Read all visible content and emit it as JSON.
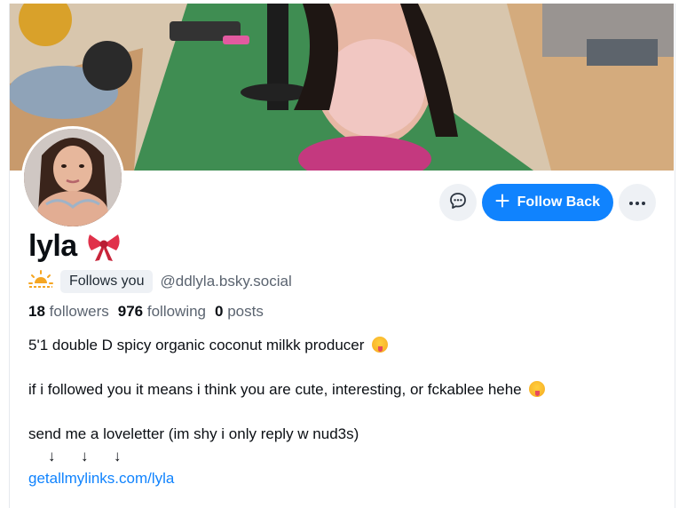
{
  "profile": {
    "display_name": "lyla",
    "name_emoji": "bow-emoji",
    "follows_you": "Follows you",
    "handle": "@ddlyla.bsky.social",
    "stats": {
      "followers_count": "18",
      "followers_label": "followers",
      "following_count": "976",
      "following_label": "following",
      "posts_count": "0",
      "posts_label": "posts"
    },
    "bio": {
      "line1": "5'1 double D spicy organic coconut milkk producer",
      "line2": "if i followed you it means i think you are cute, interesting, or fckablee hehe",
      "line3": "send me a loveletter (im shy i only reply w nud3s)",
      "arrows": [
        "↓",
        "↓",
        "↓"
      ],
      "link": "getallmylinks.com/lyla"
    }
  },
  "actions": {
    "message_icon": "chat-bubble-icon",
    "follow_back_label": "Follow Back",
    "more_icon": "ellipsis-icon"
  },
  "colors": {
    "accent": "#1083fe",
    "muted_text": "#5b6470",
    "button_bg": "#eef1f5"
  }
}
